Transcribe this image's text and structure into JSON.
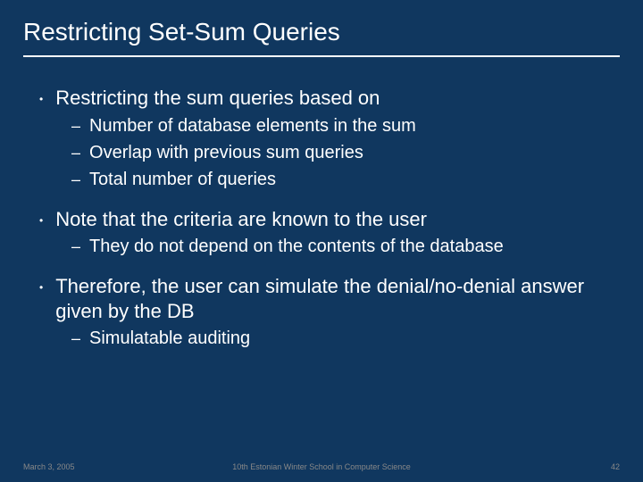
{
  "title": "Restricting Set-Sum Queries",
  "b1": {
    "text": "Restricting the sum queries based on",
    "subs": [
      "Number of database elements in the sum",
      "Overlap with previous sum queries",
      "Total number of queries"
    ]
  },
  "b2": {
    "text": "Note that the criteria are known to the user",
    "subs": [
      "They do not depend on the contents of the database"
    ]
  },
  "b3": {
    "text": "Therefore, the user can simulate the denial/no-denial answer given by the DB",
    "subs": [
      "Simulatable auditing"
    ]
  },
  "footer": {
    "date": "March 3, 2005",
    "center": "10th Estonian Winter School in Computer Science",
    "page": "42"
  }
}
